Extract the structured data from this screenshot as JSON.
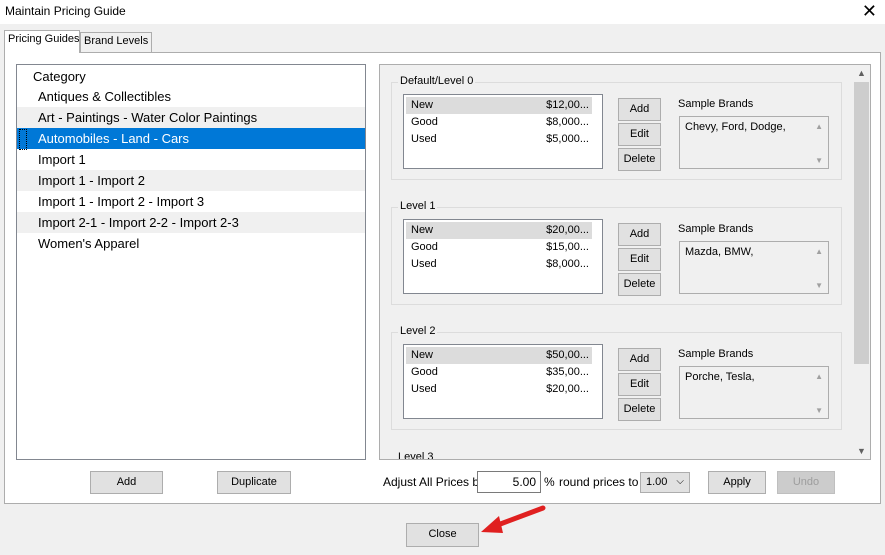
{
  "window": {
    "title": "Maintain Pricing Guide",
    "close_glyph": "✕"
  },
  "tabs": [
    {
      "label": "Pricing Guides",
      "active": true
    },
    {
      "label": "Brand Levels",
      "active": false
    }
  ],
  "categories": {
    "header": "Category",
    "items": [
      {
        "label": "Antiques & Collectibles"
      },
      {
        "label": "Art - Paintings - Water Color Paintings"
      },
      {
        "label": "Automobiles - Land - Cars",
        "selected": true
      },
      {
        "label": "Import 1"
      },
      {
        "label": "Import 1 - Import 2"
      },
      {
        "label": "Import 1 - Import 2 - Import 3"
      },
      {
        "label": "Import 2-1 - Import 2-2 - Import 2-3"
      },
      {
        "label": "Women's Apparel"
      }
    ],
    "add_label": "Add",
    "duplicate_label": "Duplicate"
  },
  "levels": [
    {
      "label": "Default/Level 0",
      "prices": [
        {
          "condition": "New",
          "price": "$12,00..."
        },
        {
          "condition": "Good",
          "price": "$8,000..."
        },
        {
          "condition": "Used",
          "price": "$5,000..."
        }
      ],
      "sample_brands_label": "Sample Brands",
      "sample_brands": "Chevy, Ford, Dodge,"
    },
    {
      "label": "Level 1",
      "prices": [
        {
          "condition": "New",
          "price": "$20,00..."
        },
        {
          "condition": "Good",
          "price": "$15,00..."
        },
        {
          "condition": "Used",
          "price": "$8,000..."
        }
      ],
      "sample_brands_label": "Sample Brands",
      "sample_brands": "Mazda, BMW,"
    },
    {
      "label": "Level 2",
      "prices": [
        {
          "condition": "New",
          "price": "$50,00..."
        },
        {
          "condition": "Good",
          "price": "$35,00..."
        },
        {
          "condition": "Used",
          "price": "$20,00..."
        }
      ],
      "sample_brands_label": "Sample Brands",
      "sample_brands": "Porche, Tesla,"
    }
  ],
  "level_partial_label": "Level 3",
  "level_buttons": {
    "add": "Add",
    "edit": "Edit",
    "delete": "Delete"
  },
  "adjust": {
    "label": "Adjust All Prices by",
    "value": "5.00",
    "percent": "%",
    "round_label": "round prices to",
    "round_value": "1.00",
    "apply_label": "Apply",
    "undo_label": "Undo"
  },
  "close_label": "Close",
  "colors": {
    "selection": "#0078d7",
    "annotation_arrow": "#e02020"
  }
}
